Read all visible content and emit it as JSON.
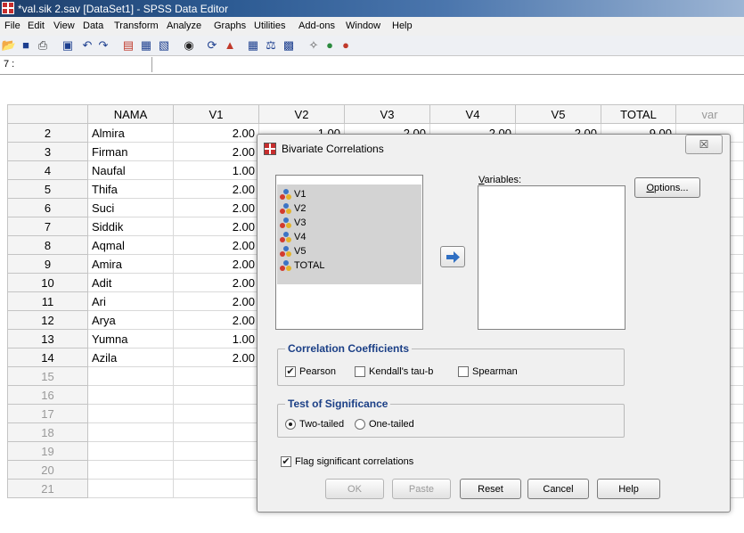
{
  "window": {
    "title": "*val.sik 2.sav [DataSet1] - SPSS Data Editor"
  },
  "menu": [
    "File",
    "Edit",
    "View",
    "Data",
    "Transform",
    "Analyze",
    "Graphs",
    "Utilities",
    "Add-ons",
    "Window",
    "Help"
  ],
  "cell_ref": "7 :",
  "grid": {
    "columns": [
      "NAMA",
      "V1",
      "V2",
      "V3",
      "V4",
      "V5",
      "TOTAL",
      "var"
    ],
    "rows": [
      {
        "n": "2",
        "nama": "Almira",
        "v1": "2.00",
        "v2": "1.00",
        "v3": "2.00",
        "v4": "2.00",
        "v5": "2.00",
        "total": "9.00"
      },
      {
        "n": "3",
        "nama": "Firman",
        "v1": "2.00"
      },
      {
        "n": "4",
        "nama": "Naufal",
        "v1": "1.00"
      },
      {
        "n": "5",
        "nama": "Thifa",
        "v1": "2.00"
      },
      {
        "n": "6",
        "nama": "Suci",
        "v1": "2.00"
      },
      {
        "n": "7",
        "nama": "Siddik",
        "v1": "2.00"
      },
      {
        "n": "8",
        "nama": "Aqmal",
        "v1": "2.00"
      },
      {
        "n": "9",
        "nama": "Amira",
        "v1": "2.00"
      },
      {
        "n": "10",
        "nama": "Adit",
        "v1": "2.00"
      },
      {
        "n": "11",
        "nama": "Ari",
        "v1": "2.00"
      },
      {
        "n": "12",
        "nama": "Arya",
        "v1": "2.00"
      },
      {
        "n": "13",
        "nama": "Yumna",
        "v1": "1.00"
      },
      {
        "n": "14",
        "nama": "Azila",
        "v1": "2.00"
      },
      {
        "n": "15"
      },
      {
        "n": "16"
      },
      {
        "n": "17"
      },
      {
        "n": "18"
      },
      {
        "n": "19"
      },
      {
        "n": "20"
      },
      {
        "n": "21"
      }
    ]
  },
  "dialog": {
    "title": "Bivariate Correlations",
    "close_glyph": "☒",
    "source_variables": [
      "V1",
      "V2",
      "V3",
      "V4",
      "V5",
      "TOTAL"
    ],
    "variables_label": "Variables:",
    "options_label": "Options...",
    "coefficients": {
      "title": "Correlation Coefficients",
      "pearson": "Pearson",
      "pearson_checked": true,
      "kendall": "Kendall's tau-b",
      "kendall_checked": false,
      "spearman": "Spearman",
      "spearman_checked": false
    },
    "significance": {
      "title": "Test of Significance",
      "two_tailed": "Two-tailed",
      "two_selected": true,
      "one_tailed": "One-tailed",
      "one_selected": false
    },
    "flag": {
      "label": "Flag significant correlations",
      "checked": true
    },
    "buttons": {
      "ok": "OK",
      "paste": "Paste",
      "reset": "Reset",
      "cancel": "Cancel",
      "help": "Help"
    }
  }
}
